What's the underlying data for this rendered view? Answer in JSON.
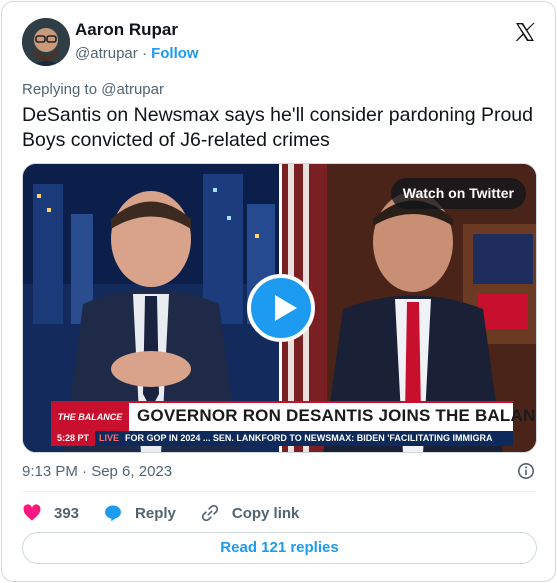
{
  "author": {
    "name": "Aaron Rupar",
    "handle": "@atrupar",
    "separator": "·",
    "follow_label": "Follow"
  },
  "reply_context": "Replying to @atrupar",
  "tweet_text": "DeSantis on Newsmax says he'll consider pardoning Proud Boys convicted of J6-related crimes",
  "media": {
    "watch_label": "Watch on Twitter",
    "chyron_logo": "THE BALANCE",
    "chyron_headline": "GOVERNOR RON DESANTIS JOINS THE BALANCE",
    "ticker_time": "5:28 PT",
    "ticker_live": "LIVE",
    "ticker_text": "FOR GOP IN 2024 ...    SEN. LANKFORD TO NEWSMAX: BIDEN 'FACILITATING IMMIGRA"
  },
  "timestamp": "9:13 PM · Sep 6, 2023",
  "actions": {
    "likes": "393",
    "reply_label": "Reply",
    "copy_label": "Copy link"
  },
  "read_replies_label": "Read 121 replies",
  "colors": {
    "accent": "#1d9bf0",
    "like": "#f91880",
    "text": "#0f1419",
    "muted": "#536471"
  }
}
